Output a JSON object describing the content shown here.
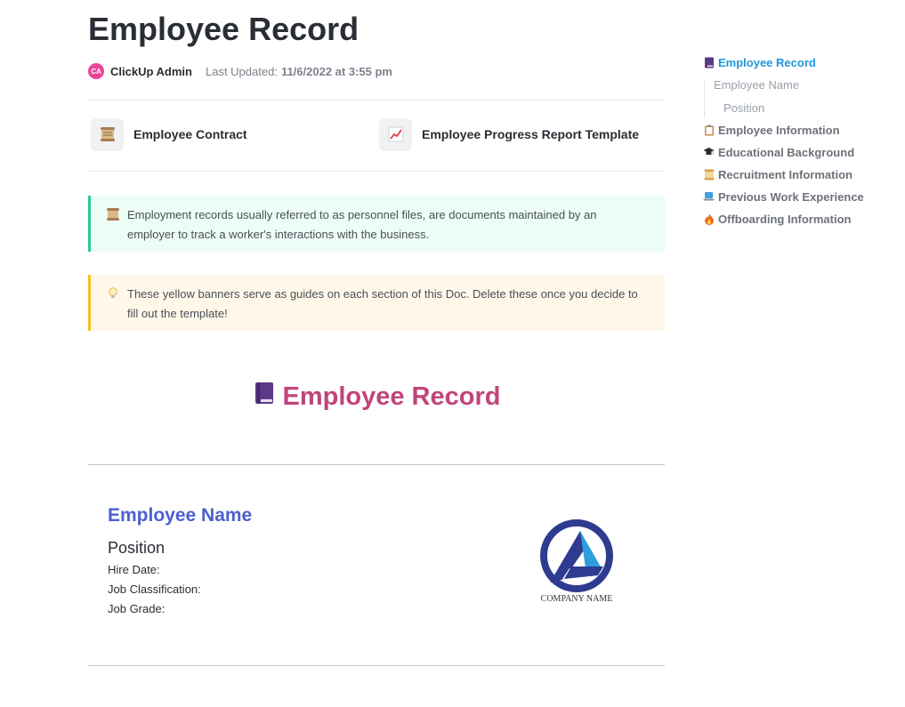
{
  "doc": {
    "title": "Employee Record",
    "author": {
      "initials": "CA",
      "name": "ClickUp Admin"
    },
    "last_updated_label": "Last Updated:",
    "last_updated_value": "11/6/2022 at 3:55 pm"
  },
  "links": [
    {
      "label": "Employee Contract",
      "icon": "scroll-icon"
    },
    {
      "label": "Employee Progress Report Template",
      "icon": "chart-increasing-icon"
    }
  ],
  "banners": {
    "info": {
      "text": "Employment records usually referred to as personnel files, are documents maintained by an employer to track a worker's interactions with the business.",
      "icon": "scroll-icon",
      "color": "#29c98f"
    },
    "guide": {
      "text": "These yellow banners serve as guides on each section of this Doc. Delete these once you decide to fill out the template!",
      "icon": "lightbulb-icon",
      "color": "#fbbf24"
    }
  },
  "section_heading": {
    "text": "Employee Record",
    "icon": "purple-book-icon",
    "color": "#c0457a"
  },
  "employee": {
    "name": "Employee Name",
    "position": "Position",
    "hire_date_label": "Hire Date:",
    "job_classification_label": "Job Classification:",
    "job_grade_label": "Job Grade:",
    "company_logo_text": "COMPANY NAME"
  },
  "toc": {
    "items": [
      {
        "label": "Employee Record",
        "icon": "purple-book-icon",
        "active": true
      },
      {
        "label": "Employee Name",
        "sub": true
      },
      {
        "label": "Position",
        "sub": true
      },
      {
        "label": "Employee Information",
        "icon": "clipboard-icon"
      },
      {
        "label": "Educational Background",
        "icon": "graduation-cap-icon"
      },
      {
        "label": "Recruitment Information",
        "icon": "scroll-icon"
      },
      {
        "label": "Previous Work Experience",
        "icon": "laptop-icon"
      },
      {
        "label": "Offboarding Information",
        "icon": "fire-icon"
      }
    ]
  },
  "colors": {
    "accent": "#1f97d8",
    "heading": "#c0457a",
    "name": "#4b5fcf",
    "avatar": "#e8459a"
  }
}
